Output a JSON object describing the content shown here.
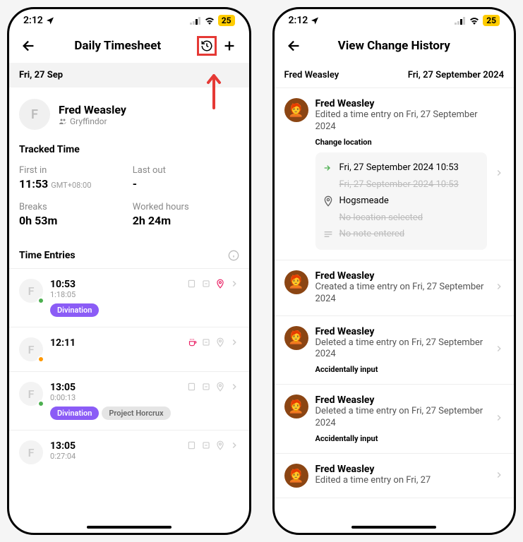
{
  "status": {
    "time": "2:12",
    "battery": "25"
  },
  "left": {
    "title": "Daily Timesheet",
    "date": "Fri, 27 Sep",
    "user": {
      "initial": "F",
      "name": "Fred Weasley",
      "group": "Gryffindor"
    },
    "tracked_heading": "Tracked Time",
    "first_in_label": "First in",
    "first_in_value": "11:53",
    "first_in_tz": "GMT+08:00",
    "last_out_label": "Last out",
    "last_out_value": "-",
    "breaks_label": "Breaks",
    "breaks_value": "0h 53m",
    "worked_label": "Worked hours",
    "worked_value": "2h 24m",
    "entries_heading": "Time Entries",
    "entries": [
      {
        "initial": "F",
        "dot": "green",
        "time": "10:53",
        "sub": "1:18:05",
        "tag": "Divination",
        "loc_active": true,
        "coffee": false
      },
      {
        "initial": "F",
        "dot": "orange",
        "time": "12:11",
        "sub": "",
        "tag": "",
        "loc_active": false,
        "coffee": true
      },
      {
        "initial": "F",
        "dot": "green",
        "time": "13:05",
        "sub": "0:00:13",
        "tag": "Divination",
        "tag2": "Project Horcrux",
        "loc_active": false,
        "coffee": false
      },
      {
        "initial": "F",
        "dot": "",
        "time": "13:05",
        "sub": "0:27:04",
        "tag": "",
        "loc_active": false,
        "coffee": false
      }
    ]
  },
  "right": {
    "title": "View Change History",
    "name": "Fred Weasley",
    "date": "Fri, 27 September 2024",
    "items": [
      {
        "name": "Fred Weasley",
        "desc": "Edited a time entry on Fri, 27 September 2024",
        "reason": "Change location",
        "detail": {
          "new_time": "Fri, 27 September 2024 10:53",
          "old_time": "Fri, 27 September 2024 10:53",
          "new_loc": "Hogsmeade",
          "old_loc": "No location selected",
          "old_note": "No note entered"
        }
      },
      {
        "name": "Fred Weasley",
        "desc": "Created a time entry on Fri, 27 September 2024",
        "reason": ""
      },
      {
        "name": "Fred Weasley",
        "desc": "Deleted a time entry on Fri, 27 September 2024",
        "reason": "Accidentally input"
      },
      {
        "name": "Fred Weasley",
        "desc": "Deleted a time entry on Fri, 27 September 2024",
        "reason": "Accidentally input"
      },
      {
        "name": "Fred Weasley",
        "desc": "Edited a time entry on Fri, 27",
        "reason": ""
      }
    ]
  }
}
